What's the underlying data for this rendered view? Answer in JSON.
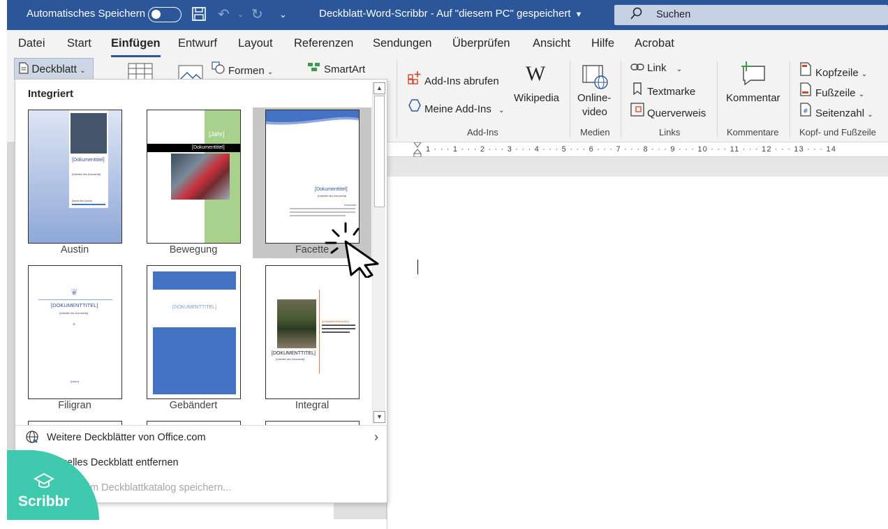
{
  "titlebar": {
    "autosave_label": "Automatisches Speichern",
    "document_title": "Deckblatt-Word-Scribbr  -  Auf \"diesem PC\" gespeichert",
    "search_placeholder": "Suchen"
  },
  "tabs": [
    {
      "label": "Datei"
    },
    {
      "label": "Start"
    },
    {
      "label": "Einfügen"
    },
    {
      "label": "Entwurf"
    },
    {
      "label": "Layout"
    },
    {
      "label": "Referenzen"
    },
    {
      "label": "Sendungen"
    },
    {
      "label": "Überprüfen"
    },
    {
      "label": "Ansicht"
    },
    {
      "label": "Hilfe"
    },
    {
      "label": "Acrobat"
    }
  ],
  "active_tab": "Einfügen",
  "ribbon": {
    "deckblatt": "Deckblatt",
    "formen": "Formen",
    "smartart": "SmartArt",
    "addins_abrufen": "Add-Ins abrufen",
    "meine_addins": "Meine Add-Ins",
    "wikipedia": "Wikipedia",
    "onlinevideo_line1": "Online-",
    "onlinevideo_line2": "video",
    "link": "Link",
    "textmarke": "Textmarke",
    "querverweis": "Querverweis",
    "kommentar": "Kommentar",
    "kopfzeile": "Kopfzeile",
    "fusszeile": "Fußzeile",
    "seitenzahl": "Seitenzahl",
    "groups": {
      "addins": "Add-Ins",
      "medien": "Medien",
      "links": "Links",
      "kommentare": "Kommentare",
      "kopf_fuss": "Kopf- und Fußzeile"
    }
  },
  "ruler": {
    "marks": "1 · · · 1 · · · 2 · · · 3 · · · 4 · · · 5 · · · 6 · · · 7 · · · 8 · · · 9 · · · 10 · · · 11 · · · 12 · · · 13 · · · 14"
  },
  "gallery": {
    "header": "Integriert",
    "templates": [
      {
        "name": "Austin",
        "title": "[Dokumenttitel]",
        "subtitle": "[Untertitel des Dokuments]",
        "author": "[Name des Autors]"
      },
      {
        "name": "Bewegung",
        "year": "[Jahr]",
        "title": "[Dokumenttitel]"
      },
      {
        "name": "Facette",
        "title": "[Dokumenttitel]",
        "subtitle": "[Untertitel des Dokuments]",
        "summary_label": "Zusammen"
      },
      {
        "name": "Filigran",
        "title": "[DOKUMENTTITEL]",
        "subtitle": "[Untertitel des Dokuments]",
        "date": "[Datum]"
      },
      {
        "name": "Gebändert",
        "title": "[DOKUMENTTITEL]"
      },
      {
        "name": "Integral",
        "title": "[DOKUMENTTITEL]",
        "subtitle": "[Untertitel des Dokuments]",
        "summary_label": "[ZUSAMMENFASSUNG]"
      }
    ],
    "selected": "Facette",
    "menu": [
      {
        "label": "Weitere Deckblätter von Office.com",
        "enabled": true
      },
      {
        "label": "Aktuelles Deckblatt entfernen",
        "enabled": true
      },
      {
        "label": "Auswahl im Deckblattkatalog speichern...",
        "enabled": false
      }
    ]
  },
  "badge": {
    "name": "Scribbr"
  },
  "colors": {
    "title_bar": "#2b579a",
    "ribbon_bg": "#f3f3f3",
    "accent_blue": "#2b579a",
    "selection_gray": "#c6c6c6",
    "scribbr_green": "#3fc9ae",
    "template_blue": "#4472c4",
    "template_green": "#a9d18e"
  }
}
